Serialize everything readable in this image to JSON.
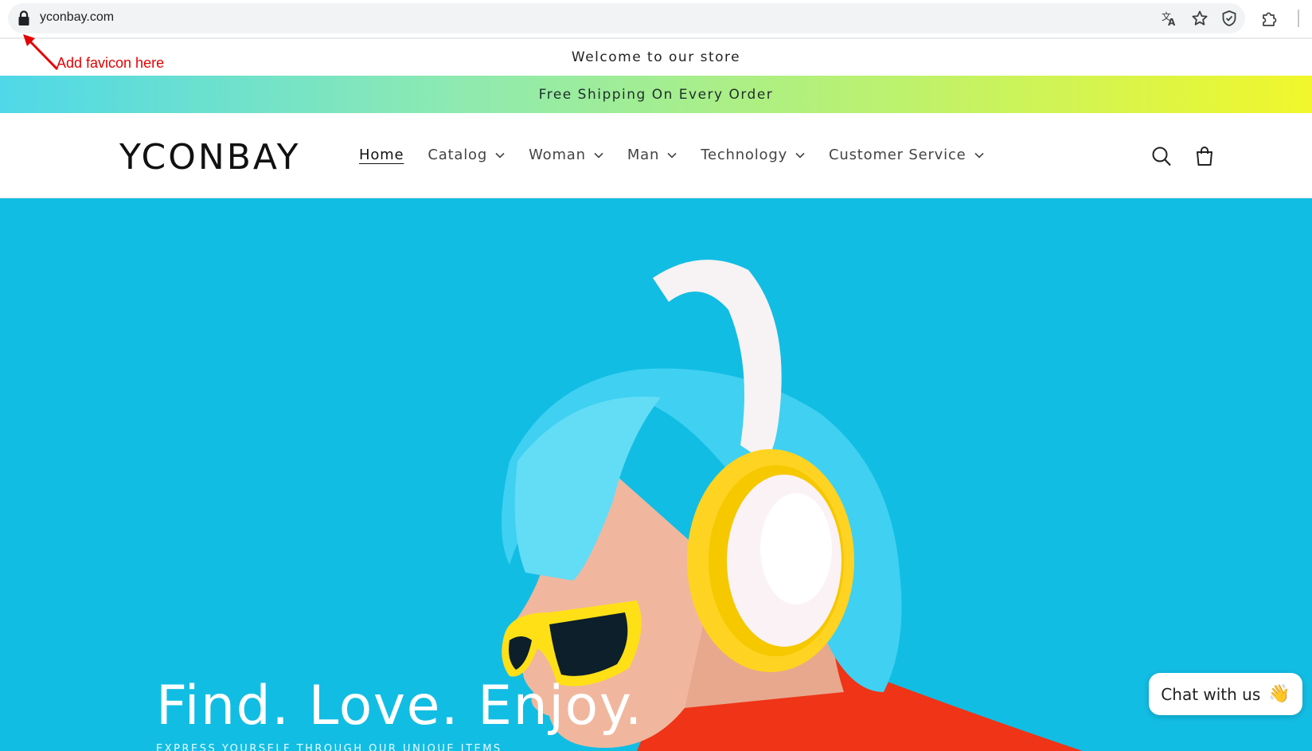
{
  "browser": {
    "url": "yconbay.com",
    "icons": [
      "lock-icon",
      "translate-icon",
      "star-icon",
      "shield-icon",
      "extensions-icon"
    ]
  },
  "annotation": {
    "text": "Add favicon here",
    "color": "#e50000"
  },
  "announcements": {
    "welcome": "Welcome to our store",
    "shipping": "Free Shipping On Every Order",
    "shipping_gradient": [
      "#4fd8e8",
      "#8eeab0",
      "#bff26a",
      "#f1f72b"
    ]
  },
  "header": {
    "logo": "YCONBAY",
    "nav": [
      {
        "label": "Home",
        "active": true,
        "dropdown": false
      },
      {
        "label": "Catalog",
        "active": false,
        "dropdown": true
      },
      {
        "label": "Woman",
        "active": false,
        "dropdown": true
      },
      {
        "label": "Man",
        "active": false,
        "dropdown": true
      },
      {
        "label": "Technology",
        "active": false,
        "dropdown": true
      },
      {
        "label": "Customer Service",
        "active": false,
        "dropdown": true
      }
    ],
    "icons": [
      "search-icon",
      "cart-icon"
    ]
  },
  "hero": {
    "title": "Find. Love. Enjoy.",
    "subtitle": "EXPRESS YOURSELF THROUGH OUR UNIQUE ITEMS",
    "background_color": "#12bde3"
  },
  "chat": {
    "label": "Chat with us",
    "emoji": "👋"
  }
}
